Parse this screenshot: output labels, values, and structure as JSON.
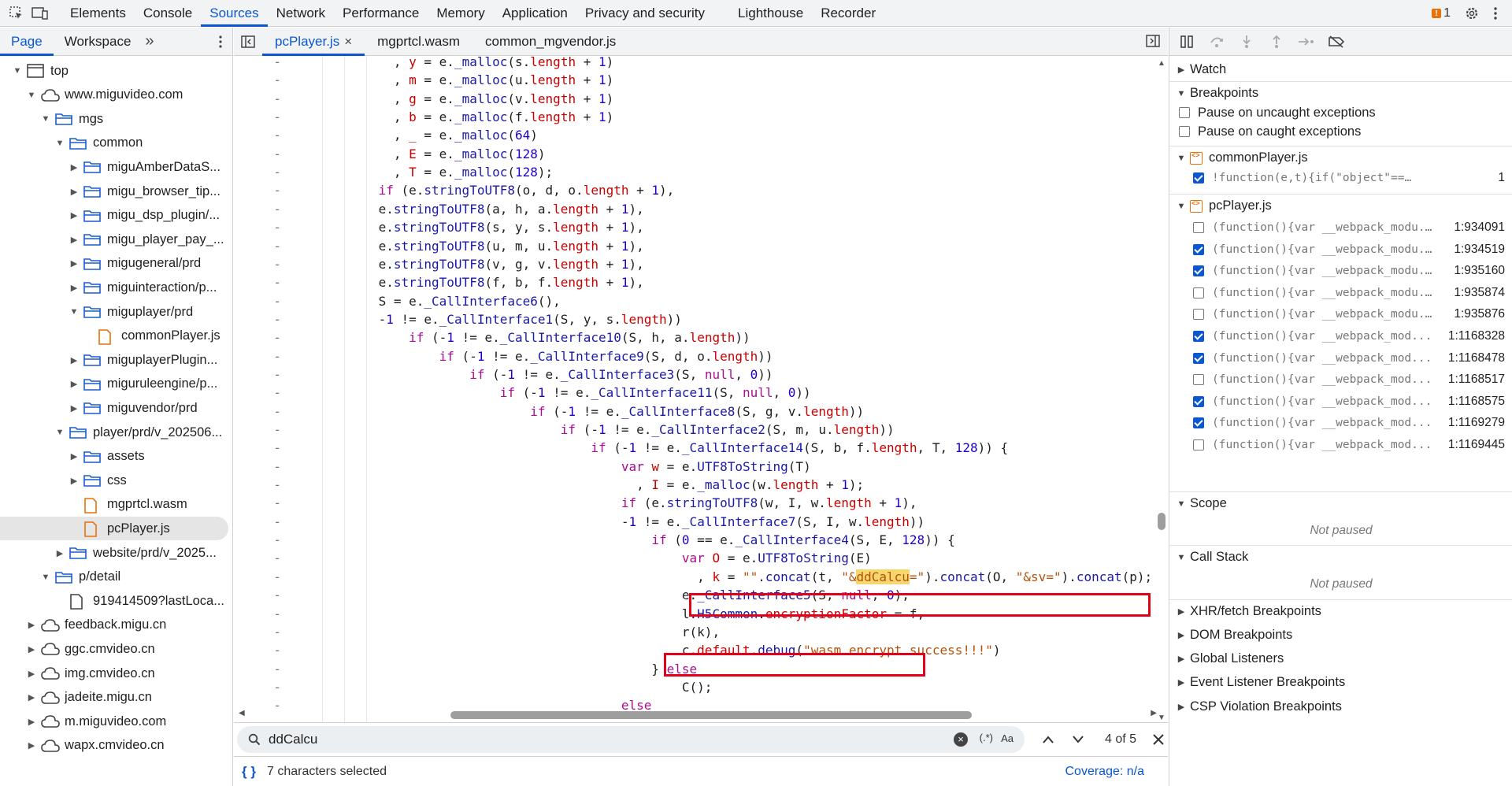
{
  "top_tabs": {
    "items": [
      "Elements",
      "Console",
      "Sources",
      "Network",
      "Performance",
      "Memory",
      "Application",
      "Privacy and security",
      "Lighthouse",
      "Recorder"
    ],
    "active": "Sources",
    "issues_count": "1"
  },
  "navigator": {
    "tabs": [
      "Page",
      "Workspace"
    ],
    "more": "»",
    "tree": [
      {
        "label": "top",
        "depth": 0,
        "arrow": "▼",
        "icon": "window-icon"
      },
      {
        "label": "www.miguvideo.com",
        "depth": 1,
        "arrow": "▼",
        "icon": "cloud-icon"
      },
      {
        "label": "mgs",
        "depth": 2,
        "arrow": "▼",
        "icon": "folder-icon"
      },
      {
        "label": "common",
        "depth": 3,
        "arrow": "▼",
        "icon": "folder-icon"
      },
      {
        "label": "miguAmberDataS...",
        "depth": 4,
        "arrow": "▶",
        "icon": "folder-icon"
      },
      {
        "label": "migu_browser_tip...",
        "depth": 4,
        "arrow": "▶",
        "icon": "folder-icon"
      },
      {
        "label": "migu_dsp_plugin/...",
        "depth": 4,
        "arrow": "▶",
        "icon": "folder-icon"
      },
      {
        "label": "migu_player_pay_...",
        "depth": 4,
        "arrow": "▶",
        "icon": "folder-icon"
      },
      {
        "label": "migugeneral/prd",
        "depth": 4,
        "arrow": "▶",
        "icon": "folder-icon"
      },
      {
        "label": "miguinteraction/p...",
        "depth": 4,
        "arrow": "▶",
        "icon": "folder-icon"
      },
      {
        "label": "miguplayer/prd",
        "depth": 4,
        "arrow": "▼",
        "icon": "folder-icon"
      },
      {
        "label": "commonPlayer.js",
        "depth": 5,
        "arrow": "",
        "icon": "file-js-icon"
      },
      {
        "label": "miguplayerPlugin...",
        "depth": 4,
        "arrow": "▶",
        "icon": "folder-icon"
      },
      {
        "label": "miguruleengine/p...",
        "depth": 4,
        "arrow": "▶",
        "icon": "folder-icon"
      },
      {
        "label": "miguvendor/prd",
        "depth": 4,
        "arrow": "▶",
        "icon": "folder-icon"
      },
      {
        "label": "player/prd/v_202506...",
        "depth": 3,
        "arrow": "▼",
        "icon": "folder-icon"
      },
      {
        "label": "assets",
        "depth": 4,
        "arrow": "▶",
        "icon": "folder-icon"
      },
      {
        "label": "css",
        "depth": 4,
        "arrow": "▶",
        "icon": "folder-icon"
      },
      {
        "label": "mgprtcl.wasm",
        "depth": 4,
        "arrow": "",
        "icon": "file-wasm-icon"
      },
      {
        "label": "pcPlayer.js",
        "depth": 4,
        "arrow": "",
        "icon": "file-js-icon",
        "selected": true
      },
      {
        "label": "website/prd/v_2025...",
        "depth": 3,
        "arrow": "▶",
        "icon": "folder-icon"
      },
      {
        "label": "p/detail",
        "depth": 2,
        "arrow": "▼",
        "icon": "folder-icon"
      },
      {
        "label": "919414509?lastLoca...",
        "depth": 3,
        "arrow": "",
        "icon": "file-doc-icon"
      },
      {
        "label": "feedback.migu.cn",
        "depth": 1,
        "arrow": "▶",
        "icon": "cloud-icon"
      },
      {
        "label": "ggc.cmvideo.cn",
        "depth": 1,
        "arrow": "▶",
        "icon": "cloud-icon"
      },
      {
        "label": "img.cmvideo.cn",
        "depth": 1,
        "arrow": "▶",
        "icon": "cloud-icon"
      },
      {
        "label": "jadeite.migu.cn",
        "depth": 1,
        "arrow": "▶",
        "icon": "cloud-icon"
      },
      {
        "label": "m.miguvideo.com",
        "depth": 1,
        "arrow": "▶",
        "icon": "cloud-icon"
      },
      {
        "label": "wapx.cmvideo.cn",
        "depth": 1,
        "arrow": "▶",
        "icon": "cloud-icon"
      }
    ]
  },
  "editor": {
    "tabs": [
      {
        "label": "pcPlayer.js",
        "active": true,
        "close": "×"
      },
      {
        "label": "mgprtcl.wasm",
        "active": false,
        "close": ""
      },
      {
        "label": "common_mgvendor.js",
        "active": false,
        "close": ""
      }
    ],
    "gutter_mark": "-",
    "lines": [
      {
        "indent": 0,
        "html": "              , <span class=\"prop\">y</span> = e.<span class=\"fn\">_malloc</span>(s.<span class=\"prop\">length</span> + <span class=\"num\">1</span>)"
      },
      {
        "indent": 0,
        "html": "              , <span class=\"prop\">m</span> = e.<span class=\"fn\">_malloc</span>(u.<span class=\"prop\">length</span> + <span class=\"num\">1</span>)"
      },
      {
        "indent": 0,
        "html": "              , <span class=\"prop\">g</span> = e.<span class=\"fn\">_malloc</span>(v.<span class=\"prop\">length</span> + <span class=\"num\">1</span>)"
      },
      {
        "indent": 0,
        "html": "              , <span class=\"prop\">b</span> = e.<span class=\"fn\">_malloc</span>(f.<span class=\"prop\">length</span> + <span class=\"num\">1</span>)"
      },
      {
        "indent": 0,
        "html": "              , <span class=\"prop\">_</span> = e.<span class=\"fn\">_malloc</span>(<span class=\"num\">64</span>)"
      },
      {
        "indent": 0,
        "html": "              , <span class=\"prop\">E</span> = e.<span class=\"fn\">_malloc</span>(<span class=\"num\">128</span>)"
      },
      {
        "indent": 0,
        "html": "              , <span class=\"prop\">T</span> = e.<span class=\"fn\">_malloc</span>(<span class=\"num\">128</span>);"
      },
      {
        "indent": 0,
        "html": "            <span class=\"kw\">if</span> (e.<span class=\"fn\">stringToUTF8</span>(o, d, o.<span class=\"prop\">length</span> + <span class=\"num\">1</span>),"
      },
      {
        "indent": 0,
        "html": "            e.<span class=\"fn\">stringToUTF8</span>(a, h, a.<span class=\"prop\">length</span> + <span class=\"num\">1</span>),"
      },
      {
        "indent": 0,
        "html": "            e.<span class=\"fn\">stringToUTF8</span>(s, y, s.<span class=\"prop\">length</span> + <span class=\"num\">1</span>),"
      },
      {
        "indent": 0,
        "html": "            e.<span class=\"fn\">stringToUTF8</span>(u, m, u.<span class=\"prop\">length</span> + <span class=\"num\">1</span>),"
      },
      {
        "indent": 0,
        "html": "            e.<span class=\"fn\">stringToUTF8</span>(v, g, v.<span class=\"prop\">length</span> + <span class=\"num\">1</span>),"
      },
      {
        "indent": 0,
        "html": "            e.<span class=\"fn\">stringToUTF8</span>(f, b, f.<span class=\"prop\">length</span> + <span class=\"num\">1</span>),"
      },
      {
        "indent": 0,
        "html": "            S = e.<span class=\"fn\">_CallInterface6</span>(),"
      },
      {
        "indent": 0,
        "html": "            -<span class=\"num\">1</span> != e.<span class=\"fn\">_CallInterface1</span>(S, y, s.<span class=\"prop\">length</span>))"
      },
      {
        "indent": 0,
        "html": "                <span class=\"kw\">if</span> (-<span class=\"num\">1</span> != e.<span class=\"fn\">_CallInterface10</span>(S, h, a.<span class=\"prop\">length</span>))"
      },
      {
        "indent": 0,
        "html": "                    <span class=\"kw\">if</span> (-<span class=\"num\">1</span> != e.<span class=\"fn\">_CallInterface9</span>(S, d, o.<span class=\"prop\">length</span>))"
      },
      {
        "indent": 0,
        "html": "                        <span class=\"kw\">if</span> (-<span class=\"num\">1</span> != e.<span class=\"fn\">_CallInterface3</span>(S, <span class=\"kw\">null</span>, <span class=\"num\">0</span>))"
      },
      {
        "indent": 0,
        "html": "                            <span class=\"kw\">if</span> (-<span class=\"num\">1</span> != e.<span class=\"fn\">_CallInterface11</span>(S, <span class=\"kw\">null</span>, <span class=\"num\">0</span>))"
      },
      {
        "indent": 0,
        "html": "                                <span class=\"kw\">if</span> (-<span class=\"num\">1</span> != e.<span class=\"fn\">_CallInterface8</span>(S, g, v.<span class=\"prop\">length</span>))"
      },
      {
        "indent": 0,
        "html": "                                    <span class=\"kw\">if</span> (-<span class=\"num\">1</span> != e.<span class=\"fn\">_CallInterface2</span>(S, m, u.<span class=\"prop\">length</span>))"
      },
      {
        "indent": 0,
        "html": "                                        <span class=\"kw\">if</span> (-<span class=\"num\">1</span> != e.<span class=\"fn\">_CallInterface14</span>(S, b, f.<span class=\"prop\">length</span>, T, <span class=\"num\">128</span>)) {"
      },
      {
        "indent": 0,
        "html": "                                            <span class=\"kw\">var</span> <span class=\"prop\">w</span> = e.<span class=\"fn\">UTF8ToString</span>(T)"
      },
      {
        "indent": 0,
        "html": "                                              , <span class=\"prop\">I</span> = e.<span class=\"fn\">_malloc</span>(w.<span class=\"prop\">length</span> + <span class=\"num\">1</span>);"
      },
      {
        "indent": 0,
        "html": "                                            <span class=\"kw\">if</span> (e.<span class=\"fn\">stringToUTF8</span>(w, I, w.<span class=\"prop\">length</span> + <span class=\"num\">1</span>),"
      },
      {
        "indent": 0,
        "html": "                                            -<span class=\"num\">1</span> != e.<span class=\"fn\">_CallInterface7</span>(S, I, w.<span class=\"prop\">length</span>))"
      },
      {
        "indent": 0,
        "html": "                                                <span class=\"kw\">if</span> (<span class=\"num\">0</span> == e.<span class=\"fn\">_CallInterface4</span>(S, E, <span class=\"num\">128</span>)) {"
      },
      {
        "indent": 0,
        "html": "                                                    <span class=\"kw\">var</span> <span class=\"prop\">O</span> = e.<span class=\"fn\">UTF8ToString</span>(E)"
      },
      {
        "indent": 0,
        "html": "                                                      , <span class=\"prop\">k</span> = <span class=\"str\">\"\"</span>.<span class=\"fn\">concat</span>(t, <span class=\"str\">\"&amp;<span class=\"hl\">ddCalcu</span>=\"</span>).<span class=\"fn\">concat</span>(O, <span class=\"str\">\"&amp;sv=\"</span>).<span class=\"fn\">concat</span>(p);"
      },
      {
        "indent": 0,
        "html": "                                                    e.<span class=\"fn\">_CallInterface5</span>(S, <span class=\"kw\">null</span>, <span class=\"num\">0</span>),"
      },
      {
        "indent": 0,
        "html": "                                                    l.<span class=\"fn\">H5Common</span>.<span class=\"prop\">encryptionFactor</span> = f,"
      },
      {
        "indent": 0,
        "html": "                                                    r(k),"
      },
      {
        "indent": 0,
        "html": "                                                    c.<span class=\"prop\">default</span>.<span class=\"fn\">debug</span>(<span class=\"str\">\"wasm encrypt success!!!\"</span>)"
      },
      {
        "indent": 0,
        "html": "                                                } <span class=\"kw\">else</span>"
      },
      {
        "indent": 0,
        "html": "                                                    C();"
      },
      {
        "indent": 0,
        "html": "                                            <span class=\"kw\">else</span>"
      }
    ]
  },
  "search": {
    "value": "ddCalcu",
    "regex_label": "(.*)",
    "case_label": "Aa",
    "match_count": "4 of 5"
  },
  "status": {
    "braces": "{ }",
    "selection": "7 characters selected",
    "coverage": "Coverage: n/a"
  },
  "debugger": {
    "watch": "Watch",
    "breakpoints": "Breakpoints",
    "pause_uncaught": "Pause on uncaught exceptions",
    "pause_caught": "Pause on caught exceptions",
    "common_file": "commonPlayer.js",
    "common_bp": {
      "code": "!function(e,t){if(\"object\"==typeof ...",
      "line": "1",
      "checked": true
    },
    "pc_file": "pcPlayer.js",
    "pc_bps": [
      {
        "code": "(function(){var __webpack_modu...",
        "line": "1:934091",
        "checked": false
      },
      {
        "code": "(function(){var __webpack_modu...",
        "line": "1:934519",
        "checked": true
      },
      {
        "code": "(function(){var __webpack_modu...",
        "line": "1:935160",
        "checked": true
      },
      {
        "code": "(function(){var __webpack_modu...",
        "line": "1:935874",
        "checked": false
      },
      {
        "code": "(function(){var __webpack_modu...",
        "line": "1:935876",
        "checked": false
      },
      {
        "code": "(function(){var __webpack_mod...",
        "line": "1:1168328",
        "checked": true
      },
      {
        "code": "(function(){var __webpack_mod...",
        "line": "1:1168478",
        "checked": true
      },
      {
        "code": "(function(){var __webpack_mod...",
        "line": "1:1168517",
        "checked": false
      },
      {
        "code": "(function(){var __webpack_mod...",
        "line": "1:1168575",
        "checked": true
      },
      {
        "code": "(function(){var __webpack_mod...",
        "line": "1:1169279",
        "checked": true
      },
      {
        "code": "(function(){var __webpack_mod...",
        "line": "1:1169445",
        "checked": false
      }
    ],
    "scope": "Scope",
    "scope_status": "Not paused",
    "call_stack": "Call Stack",
    "call_stack_status": "Not paused",
    "sections": [
      "XHR/fetch Breakpoints",
      "DOM Breakpoints",
      "Global Listeners",
      "Event Listener Breakpoints",
      "CSP Violation Breakpoints"
    ]
  },
  "colors": {
    "accent": "#0b57d0",
    "highlight_box": "#e3001b",
    "search_highlight": "#f5d76e"
  }
}
